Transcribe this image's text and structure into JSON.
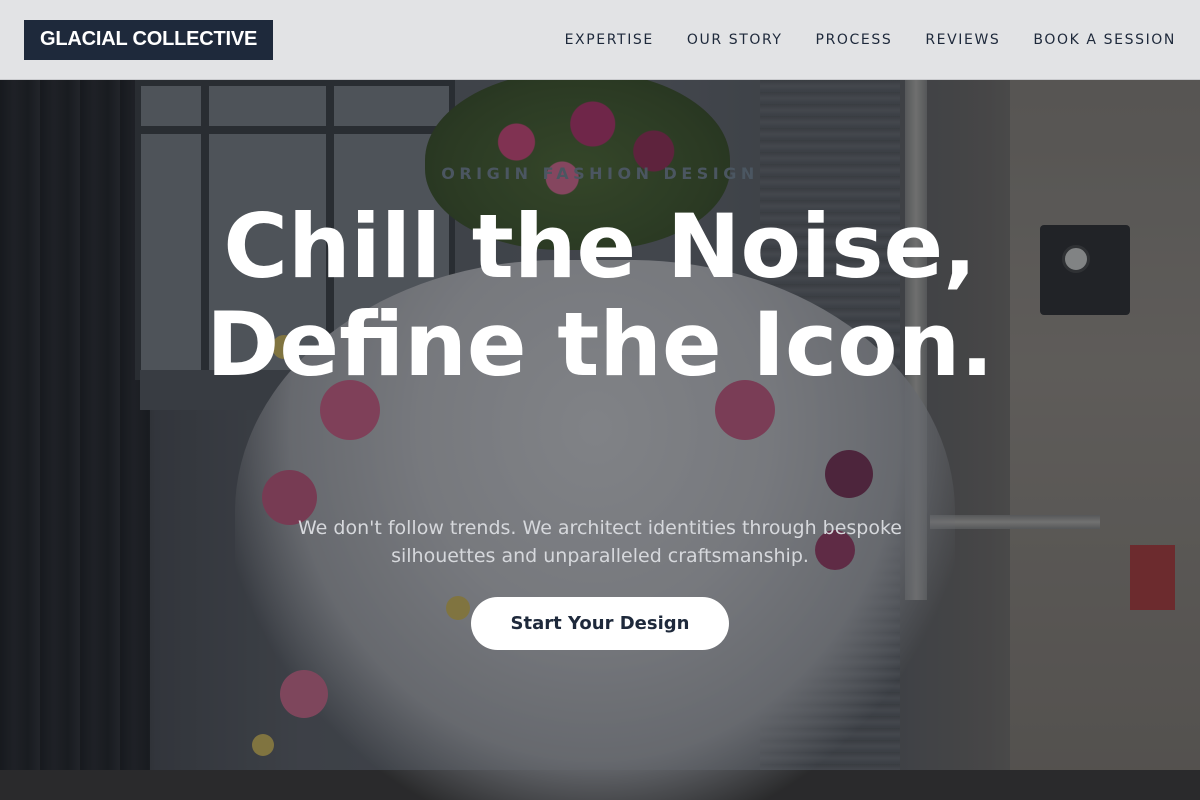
{
  "header": {
    "logo_text": "GLACIAL COLLECTIVE",
    "nav": [
      {
        "label": "EXPERTISE"
      },
      {
        "label": "OUR STORY"
      },
      {
        "label": "PROCESS"
      },
      {
        "label": "REVIEWS"
      },
      {
        "label": "BOOK A SESSION"
      }
    ]
  },
  "hero": {
    "eyebrow": "Origin Fashion Design",
    "headline": "Chill the Noise, Define the Icon.",
    "subtext": "We don't follow trends. We architect identities through bespoke silhouettes and unparalleled craftsmanship.",
    "cta_label": "Start Your Design"
  },
  "colors": {
    "brand_navy": "#1e293b",
    "header_bg": "#e2e3e5",
    "cta_bg": "#ffffff"
  }
}
